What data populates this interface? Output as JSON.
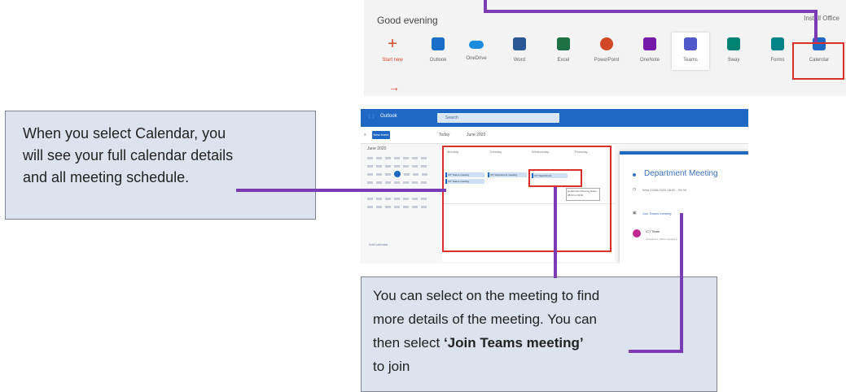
{
  "office": {
    "greeting": "Good evening",
    "install": "Install Office",
    "start_new": "Start new",
    "apps": [
      {
        "label": "Outlook",
        "color": "#1c6fc8"
      },
      {
        "label": "OneDrive",
        "color": "#1d8ce0"
      },
      {
        "label": "Word",
        "color": "#2b5797"
      },
      {
        "label": "Excel",
        "color": "#1e7145"
      },
      {
        "label": "PowerPoint",
        "color": "#d24726"
      },
      {
        "label": "OneNote",
        "color": "#7719aa"
      },
      {
        "label": "Teams",
        "color": "#5059c9"
      },
      {
        "label": "Sway",
        "color": "#008272"
      },
      {
        "label": "Forms",
        "color": "#038387"
      },
      {
        "label": "Calendar",
        "color": "#1f68c4"
      }
    ]
  },
  "outlook": {
    "brand": "Outlook",
    "search_placeholder": "Search",
    "new_event": "New event",
    "today": "Today",
    "month_nav": "June 2020",
    "mini_month": "June 2020",
    "add_calendar": "Add calendar",
    "day_headers": [
      "Monday",
      "Tuesday",
      "Wednesday",
      "Thursday"
    ],
    "events": [
      "ICT Teams meeting",
      "ICT Teams meeting",
      "ICT Department",
      "ICT Department meeting"
    ],
    "tooltip": "Department Meeting Dates 08:00 to 09:00",
    "detail": {
      "title": "Department Meeting",
      "time": "Wed 03/06/2020 08:00 - 09:00",
      "join": "Join Teams meeting",
      "organizer": "ICT Team",
      "accepted": "Accepted 1, Didn't respond 2"
    }
  },
  "callout_left": {
    "line1": "When you select Calendar, you",
    "line2": "will see your full calendar details",
    "line3": "and all meeting schedule."
  },
  "callout_bottom": {
    "line1": "You can select on the meeting to find",
    "line2": "more details of the meeting. You can",
    "line3_pre": "then select ",
    "line3_bold": "‘Join Teams meeting’",
    "line4": "to join"
  },
  "colors": {
    "connector": "#7a3bb3",
    "highlight": "#d9302b",
    "callout_bg": "#dde3ee"
  }
}
